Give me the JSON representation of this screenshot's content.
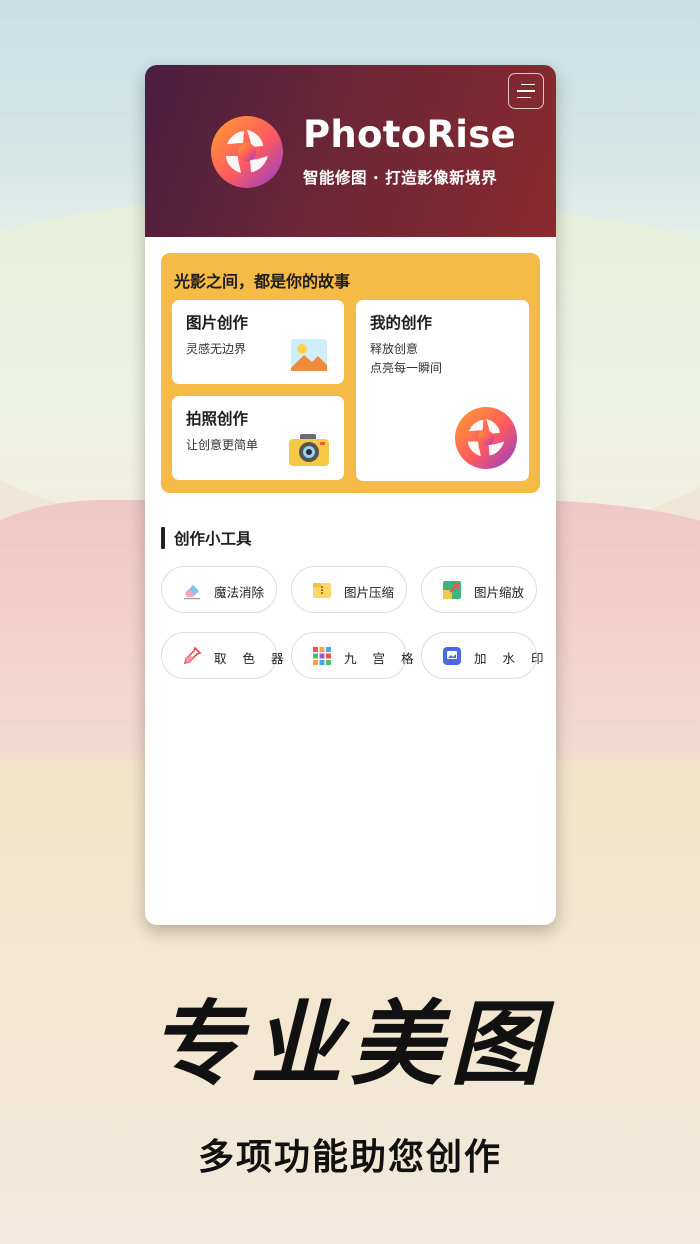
{
  "app": {
    "name": "PhotoRise",
    "tagline": "智能修图 · 打造影像新境界"
  },
  "features": {
    "title": "光影之间，都是你的故事",
    "cards": [
      {
        "title": "图片创作",
        "desc": "灵感无边界",
        "icon": "picture-icon"
      },
      {
        "title": "拍照创作",
        "desc": "让创意更简单",
        "icon": "camera-icon"
      },
      {
        "title": "我的创作",
        "desc_lines": [
          "释放创意",
          "点亮每一瞬间"
        ],
        "icon": "app-logo-icon"
      }
    ]
  },
  "tools": {
    "title": "创作小工具",
    "items": [
      {
        "label": "魔法消除",
        "icon": "eraser-icon"
      },
      {
        "label": "图片压缩",
        "icon": "folder-compress-icon"
      },
      {
        "label": "图片缩放",
        "icon": "resize-icon"
      },
      {
        "label": "取 色 器",
        "icon": "color-picker-icon"
      },
      {
        "label": "九 宫 格",
        "icon": "grid-icon"
      },
      {
        "label": "加 水 印",
        "icon": "watermark-icon"
      }
    ]
  },
  "promo": {
    "headline": "专业美图",
    "subline": "多项功能助您创作"
  },
  "colors": {
    "hero_start": "#4a1f3f",
    "hero_end": "#8b2a2d",
    "feature_bg": "#f6bb46"
  }
}
